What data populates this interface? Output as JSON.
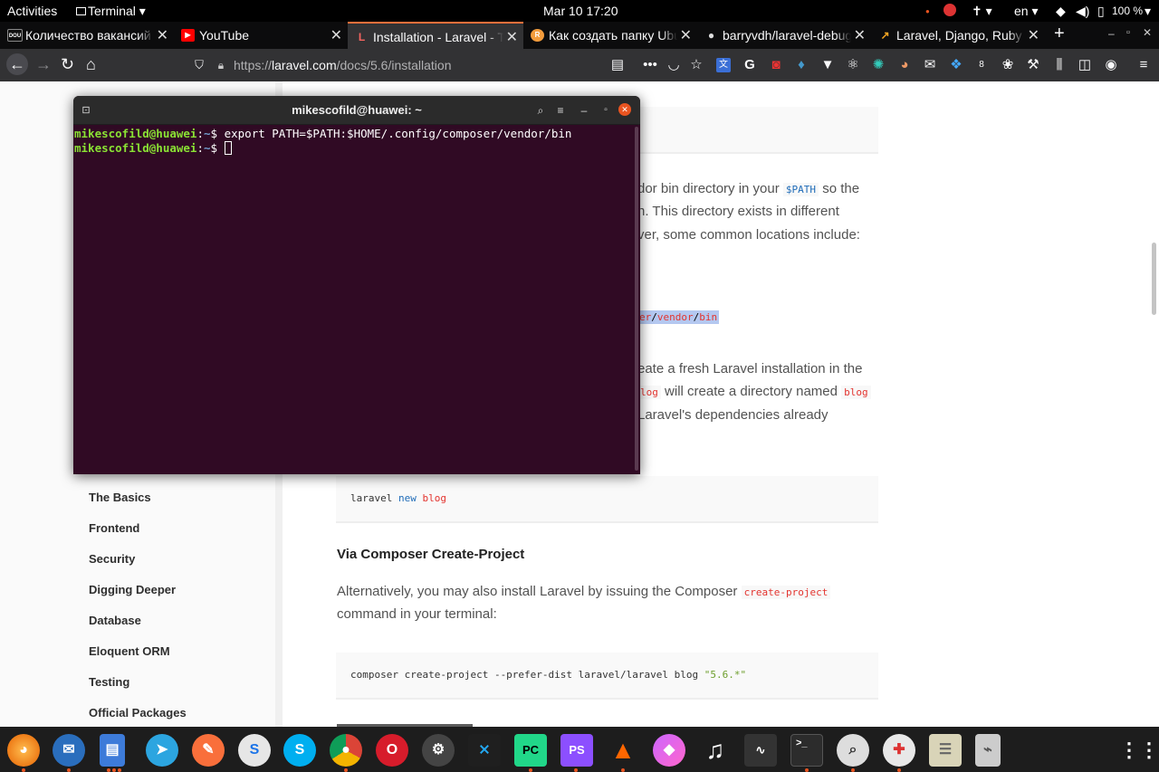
{
  "topbar": {
    "activities": "Activities",
    "app_menu": "Terminal ▾",
    "clock": "Mar 10  17:20",
    "lang": "en ▾",
    "battery": "100 %"
  },
  "tabs": [
    {
      "title": "Количество вакансий",
      "favicon_text": "DOU"
    },
    {
      "title": "YouTube",
      "favicon_text": "▶"
    },
    {
      "title": "Installation - Laravel - T",
      "favicon_text": "L"
    },
    {
      "title": "Как создать папку Ubu",
      "favicon_text": "R"
    },
    {
      "title": "barryvdh/laravel-debug",
      "favicon_text": "●"
    },
    {
      "title": "Laravel, Django, Ruby o",
      "favicon_text": "↗"
    }
  ],
  "new_tab": "+",
  "url": {
    "prefix": "https://",
    "domain": "laravel.com",
    "path": "/docs/5.6/installation"
  },
  "terminal": {
    "title": "mikescofild@huawei: ~",
    "line1_user": "mikescofild@huawei",
    "line1_sep": ":",
    "line1_path": "~",
    "line1_prompt": "$ ",
    "line1_cmd": "export PATH=$PATH:$HOME/.config/composer/vendor/bin",
    "line2_user": "mikescofild@huawei",
    "line2_sep": ":",
    "line2_path": "~",
    "line2_prompt": "$ "
  },
  "sidebar": {
    "items": [
      "The Basics",
      "Frontend",
      "Security",
      "Digging Deeper",
      "Database",
      "Eloquent ORM",
      "Testing",
      "Official Packages"
    ]
  },
  "content": {
    "p1_l1a": "dor bin directory in your",
    "p1_l1_code": "$PATH",
    "p1_l1b": "so the",
    "p1_l2": "n. This directory exists in different",
    "p1_l3": "ver, some common locations include:",
    "path_code_a": "er",
    "path_code_b": "/",
    "path_code_c": "vendor",
    "path_code_d": "/",
    "path_code_e": "bin",
    "p2_l1": "eate a fresh Laravel installation in the",
    "p2_l2_code": "log",
    "p2_l2": "will create a directory named",
    "p2_l2_code2": "blog",
    "p2_l3": "Laravel's dependencies already",
    "code1_a": "laravel",
    "code1_b": "new",
    "code1_c": "blog",
    "heading": "Via Composer Create-Project",
    "p3_l1": "Alternatively, you may also install Laravel by issuing the Composer",
    "p3_code": "create-project",
    "p3_l2": "command in your terminal:",
    "code2_a": "composer create-project --prefer-dist laravel/laravel blog",
    "code2_b": "\"5.6.*\""
  },
  "colors": {
    "terminal_bg": "#300a24",
    "prompt_user": "#8ae234",
    "prompt_path": "#729fcf",
    "tab_accent": "#f96f3b"
  }
}
